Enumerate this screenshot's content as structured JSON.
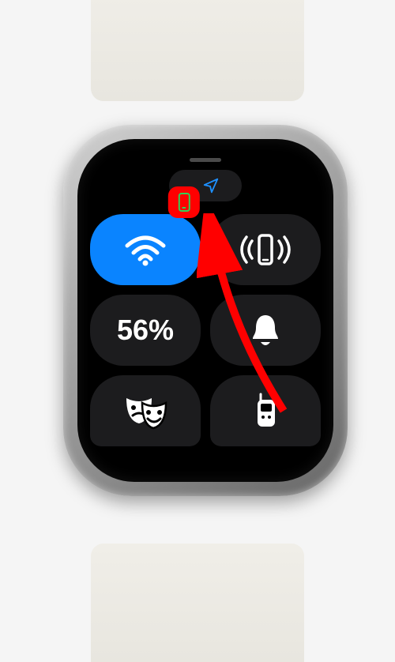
{
  "grabber": {
    "name": "grabber-handle"
  },
  "status": {
    "phone_connected_icon": "phone-connected-icon",
    "location_icon": "location-arrow-icon"
  },
  "tiles": {
    "wifi": {
      "name": "wifi-tile",
      "icon": "wifi-icon",
      "active": true
    },
    "ping": {
      "name": "ping-iphone-tile",
      "icon": "ping-phone-icon"
    },
    "battery": {
      "name": "battery-tile",
      "label": "56%"
    },
    "silent": {
      "name": "silent-mode-tile",
      "icon": "bell-icon"
    },
    "theater": {
      "name": "theater-mode-tile",
      "icon": "theater-masks-icon"
    },
    "walkie": {
      "name": "walkie-talkie-tile",
      "icon": "walkie-talkie-icon"
    }
  },
  "annotation": {
    "highlight": "phone-connected-highlight",
    "arrow": "pointer-arrow"
  },
  "colors": {
    "active_blue": "#0a84ff",
    "status_green": "#30d158",
    "tile_bg": "#1c1c1e",
    "highlight_red": "#ff0000",
    "location_blue": "#1e90ff"
  }
}
